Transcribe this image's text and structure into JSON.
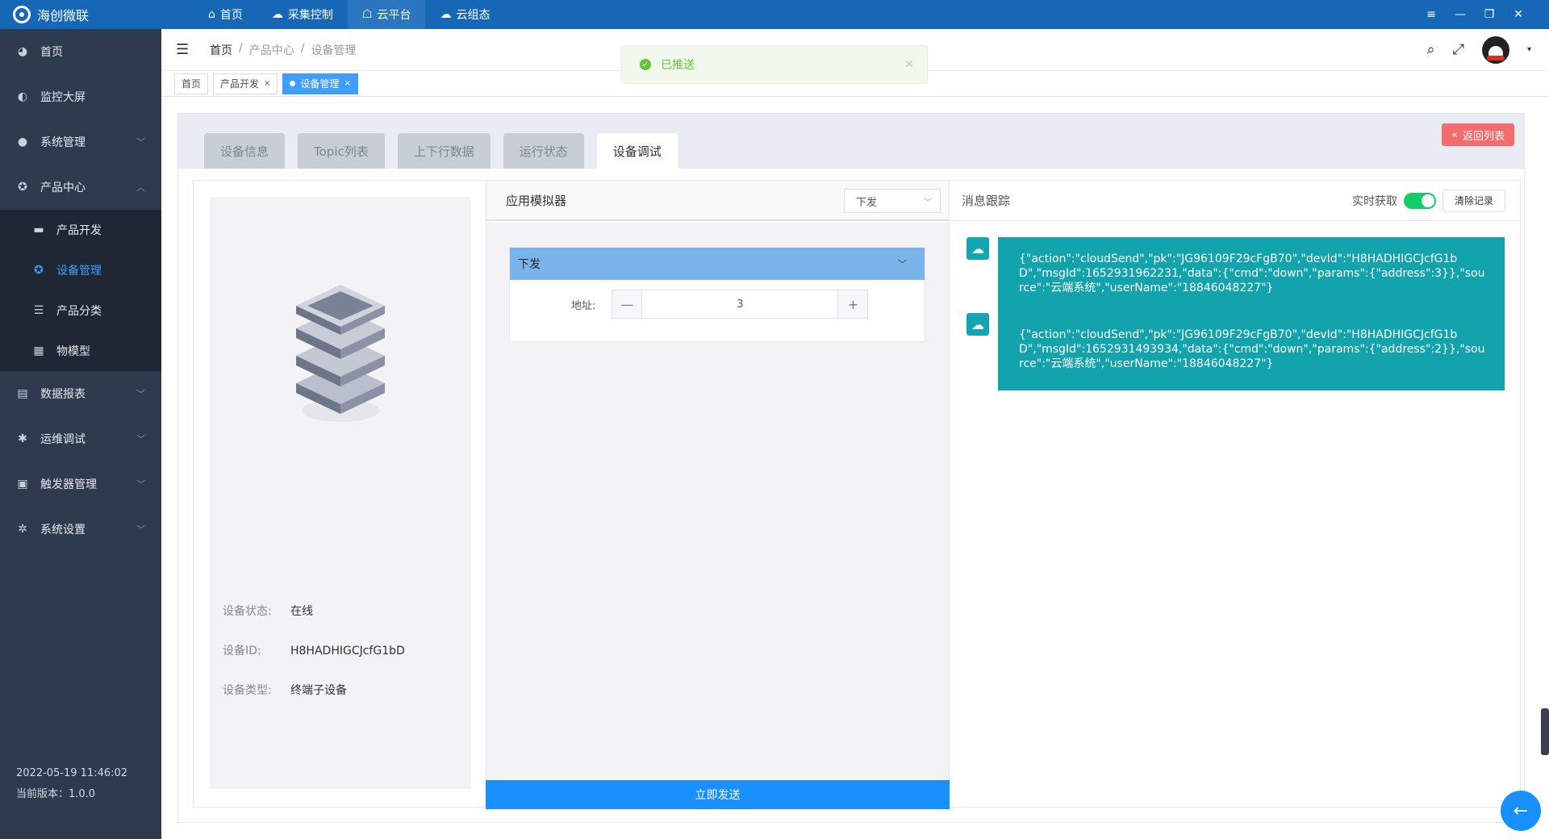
{
  "app": {
    "title": "海创微联"
  },
  "topnav": [
    {
      "label": "首页",
      "icon": "home-icon"
    },
    {
      "label": "采集控制",
      "icon": "cloud-icon"
    },
    {
      "label": "云平台",
      "icon": "cloud-house-icon"
    },
    {
      "label": "云组态",
      "icon": "cloud-sync-icon"
    }
  ],
  "window_controls": [
    "≡",
    "—",
    "❐",
    "✕"
  ],
  "sidebar": {
    "items": [
      {
        "label": "首页"
      },
      {
        "label": "监控大屏"
      },
      {
        "label": "系统管理"
      },
      {
        "label": "产品中心"
      }
    ],
    "sub_items": [
      {
        "label": "产品开发"
      },
      {
        "label": "设备管理"
      },
      {
        "label": "产品分类"
      },
      {
        "label": "物模型"
      }
    ],
    "items2": [
      {
        "label": "数据报表"
      },
      {
        "label": "运维调试"
      },
      {
        "label": "触发器管理"
      },
      {
        "label": "系统设置"
      }
    ],
    "footer": {
      "datetime": "2022-05-19 11:46:02",
      "version": "当前版本：1.0.0"
    }
  },
  "breadcrumb": [
    "首页",
    "/",
    "产品中心",
    "/",
    "设备管理"
  ],
  "tags": [
    {
      "label": "首页"
    },
    {
      "label": "产品开发",
      "close": "×"
    },
    {
      "label": "设备管理",
      "close": "×"
    }
  ],
  "toast": {
    "text": "已推送",
    "close": "✕"
  },
  "tabs": [
    "设备信息",
    "Topic列表",
    "上下行数据",
    "运行状态",
    "设备调试"
  ],
  "back_button": "返回列表",
  "device": {
    "status_label": "设备状态:",
    "status_value": "在线",
    "id_label": "设备ID:",
    "id_value": "H8HADHIGCJcfG1bD",
    "type_label": "设备类型:",
    "type_value": "终端子设备"
  },
  "simulator": {
    "title": "应用模拟器",
    "select_value": "下发",
    "panel_title": "下发",
    "field_label": "地址:",
    "field_value": "3",
    "minus": "—",
    "plus": "+",
    "send_button": "立即发送"
  },
  "trace": {
    "title": "消息跟踪",
    "realtime_label": "实时获取",
    "realtime_on": true,
    "clear_button": "清除记录",
    "messages": [
      "{\"action\":\"cloudSend\",\"pk\":\"JG96109F29cFgB70\",\"devId\":\"H8HADHIGCJcfG1bD\",\"msgId\":1652931962231,\"data\":{\"cmd\":\"down\",\"params\":{\"address\":3}},\"source\":\"云端系统\",\"userName\":\"18846048227\"}",
      "{\"action\":\"cloudSend\",\"pk\":\"JG96109F29cFgB70\",\"devId\":\"H8HADHIGCJcfG1bD\",\"msgId\":1652931493934,\"data\":{\"cmd\":\"down\",\"params\":{\"address\":2}},\"source\":\"云端系统\",\"userName\":\"18846048227\"}"
    ]
  },
  "colors": {
    "topbar": "#1668b7",
    "sidebar": "#2e3a4e",
    "accent": "#1890ff",
    "message": "#12a3ad",
    "danger": "#f56c6c",
    "success": "#13ce66"
  }
}
